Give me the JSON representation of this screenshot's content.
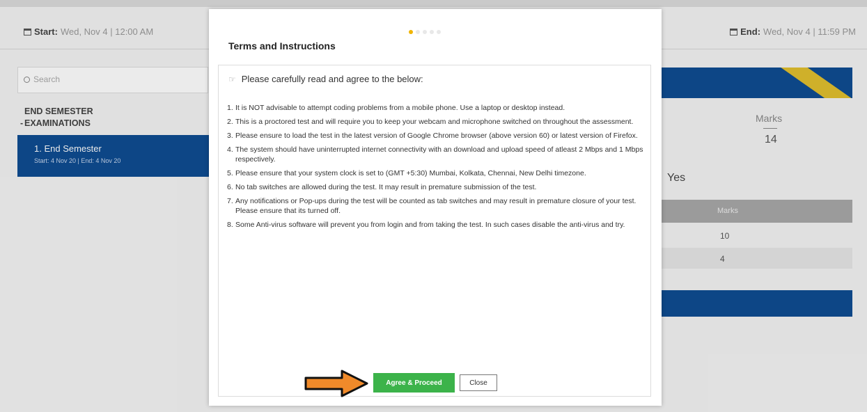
{
  "header": {
    "start_label": "Start:",
    "start_value": "Wed, Nov 4 | 12:00 AM",
    "end_label": "End:",
    "end_value": "Wed, Nov 4 | 11:59 PM"
  },
  "sidebar": {
    "search_placeholder": "Search",
    "section_title_line1": "END SEMESTER",
    "section_title_line2": "EXAMINATIONS",
    "collapse_symbol": "-",
    "active_item_title": "1. End Semester",
    "active_item_sub": "Start: 4 Nov 20 | End: 4 Nov 20"
  },
  "right_panel": {
    "marks_label": "Marks",
    "marks_value": "14",
    "yes_text": "Yes",
    "table_header": "Marks",
    "rows": [
      "10",
      "4"
    ]
  },
  "modal": {
    "title": "Terms and Instructions",
    "intro": "Please carefully read and agree to the below:",
    "items": [
      {
        "num": "1.",
        "text": "It is NOT advisable to attempt coding problems from a mobile phone. Use a laptop or desktop instead."
      },
      {
        "num": "2.",
        "text": "This is a proctored test and will require you to keep your webcam and microphone switched on throughout the assessment."
      },
      {
        "num": "3.",
        "text": "Please ensure to load the test in the latest version of Google Chrome browser (above version 60) or latest version of Firefox."
      },
      {
        "num": "4.",
        "text": "The system should have uninterrupted internet connectivity with an download and upload speed of atleast 2 Mbps and 1 Mbps respectively."
      },
      {
        "num": "5.",
        "text": "Please ensure that your system clock is set to (GMT +5:30) Mumbai, Kolkata, Chennai, New Delhi timezone."
      },
      {
        "num": "6.",
        "text": "No tab switches are allowed during the test. It may result in premature submission of the test."
      },
      {
        "num": "7.",
        "text": "Any notifications or Pop-ups during the test will be counted as tab switches and may result in premature closure of your test. Please ensure that its turned off."
      },
      {
        "num": "8.",
        "text": "Some Anti-virus software will prevent you from login and from taking the test. In such cases disable the anti-virus and try."
      }
    ],
    "agree_label": "Agree & Proceed",
    "close_label": "Close"
  },
  "colors": {
    "primary_blue": "#0f4c92",
    "agree_green": "#3cb34a",
    "arrow_orange": "#f08a2a",
    "step_active": "#f0b400"
  }
}
